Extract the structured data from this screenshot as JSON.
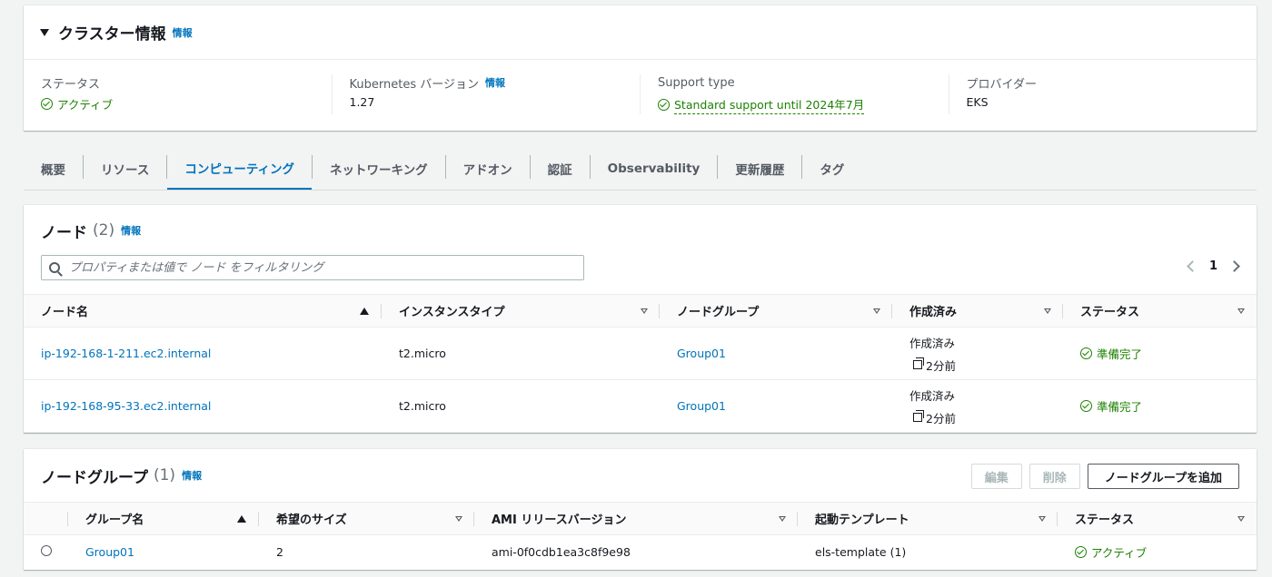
{
  "cluster": {
    "title": "クラスター情報",
    "info": "情報",
    "status_label": "ステータス",
    "status_value": "アクティブ",
    "k8s_label": "Kubernetes バージョン",
    "k8s_info": "情報",
    "k8s_value": "1.27",
    "support_label": "Support type",
    "support_value": "Standard support until 2024年7月",
    "provider_label": "プロバイダー",
    "provider_value": "EKS"
  },
  "tabs": [
    {
      "label": "概要"
    },
    {
      "label": "リソース"
    },
    {
      "label": "コンピューティング",
      "active": true
    },
    {
      "label": "ネットワーキング"
    },
    {
      "label": "アドオン"
    },
    {
      "label": "認証"
    },
    {
      "label": "Observability"
    },
    {
      "label": "更新履歴"
    },
    {
      "label": "タグ"
    }
  ],
  "nodes": {
    "title": "ノード",
    "count": "(2)",
    "info": "情報",
    "filter_placeholder": "プロパティまたは値で ノード をフィルタリング",
    "page": "1",
    "columns": [
      "ノード名",
      "インスタンスタイプ",
      "ノードグループ",
      "作成済み",
      "ステータス"
    ],
    "rows": [
      {
        "name": "ip-192-168-1-211.ec2.internal",
        "type": "t2.micro",
        "group": "Group01",
        "created_label": "作成済み",
        "created_ago": "2分前",
        "status": "準備完了"
      },
      {
        "name": "ip-192-168-95-33.ec2.internal",
        "type": "t2.micro",
        "group": "Group01",
        "created_label": "作成済み",
        "created_ago": "2分前",
        "status": "準備完了"
      }
    ]
  },
  "nodegroups": {
    "title": "ノードグループ",
    "count": "(1)",
    "info": "情報",
    "edit_label": "編集",
    "delete_label": "削除",
    "add_label": "ノードグループを追加",
    "columns": [
      "グループ名",
      "希望のサイズ",
      "AMI リリースバージョン",
      "起動テンプレート",
      "ステータス"
    ],
    "rows": [
      {
        "name": "Group01",
        "desired": "2",
        "ami": "ami-0f0cdb1ea3c8f9e98",
        "template": "els-template (1)",
        "status": "アクティブ"
      }
    ]
  },
  "colors": {
    "accent": "#0073bb",
    "success": "#1d8102",
    "background": "#f2f3f3"
  }
}
